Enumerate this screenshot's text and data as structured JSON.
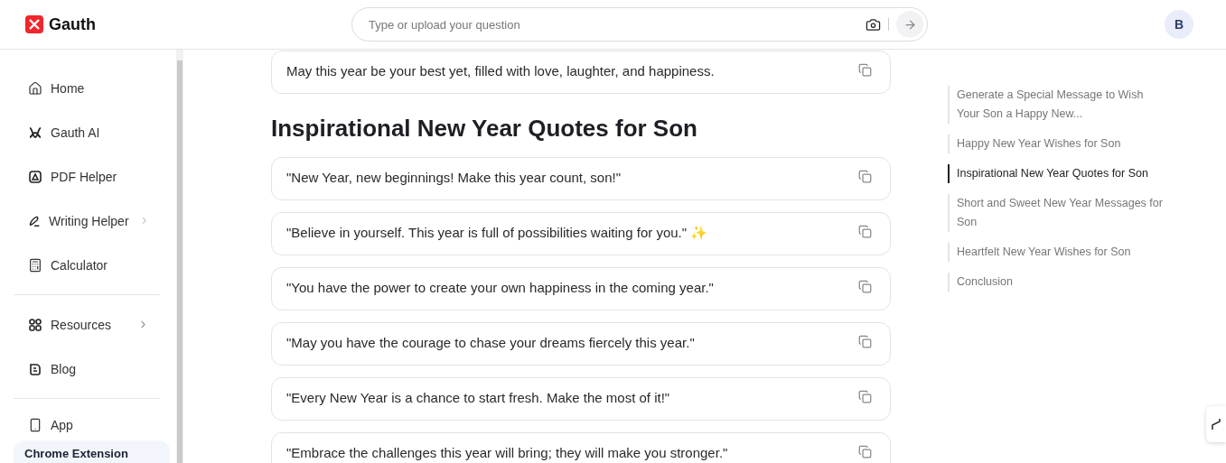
{
  "header": {
    "logo": "Gauth",
    "search": {
      "placeholder": "Type or upload your question"
    },
    "avatar": "B"
  },
  "sidebar": {
    "groups": [
      [
        {
          "label": "Home",
          "kind": "link"
        },
        {
          "label": "Gauth AI",
          "kind": "link"
        },
        {
          "label": "PDF Helper",
          "kind": "link"
        },
        {
          "label": "Writing Helper",
          "kind": "submenu"
        },
        {
          "label": "Calculator",
          "kind": "link"
        }
      ],
      [
        {
          "label": "Resources",
          "kind": "submenu"
        },
        {
          "label": "Blog",
          "kind": "link"
        }
      ],
      [
        {
          "label": "App",
          "kind": "link"
        }
      ]
    ],
    "promo": "Chrome Extension"
  },
  "content": {
    "blocks": [
      {
        "kind": "card",
        "text": "May this year be your best yet, filled with love, laughter, and happiness."
      },
      {
        "kind": "heading",
        "text": "Inspirational New Year Quotes for Son"
      },
      {
        "kind": "card",
        "text": "\"New Year, new beginnings! Make this year count, son!\""
      },
      {
        "kind": "card",
        "text": "\"Believe in yourself. This year is full of possibilities waiting for you.\" ✨"
      },
      {
        "kind": "card",
        "text": "\"You have the power to create your own happiness in the coming year.\""
      },
      {
        "kind": "card",
        "text": "\"May you have the courage to chase your dreams fiercely this year.\""
      },
      {
        "kind": "card",
        "text": "\"Every New Year is a chance to start fresh. Make the most of it!\""
      },
      {
        "kind": "card",
        "text": "\"Embrace the challenges this year will bring; they will make you stronger.\""
      }
    ]
  },
  "toc": [
    {
      "label": "Generate a Special Message to Wish Your Son a Happy New...",
      "selected": false
    },
    {
      "label": "Happy New Year Wishes for Son",
      "selected": false
    },
    {
      "label": "Inspirational New Year Quotes for Son",
      "selected": true
    },
    {
      "label": "Short and Sweet New Year Messages for Son",
      "selected": false
    },
    {
      "label": "Heartfelt New Year Wishes for Son",
      "selected": false
    },
    {
      "label": "Conclusion",
      "selected": false
    }
  ]
}
